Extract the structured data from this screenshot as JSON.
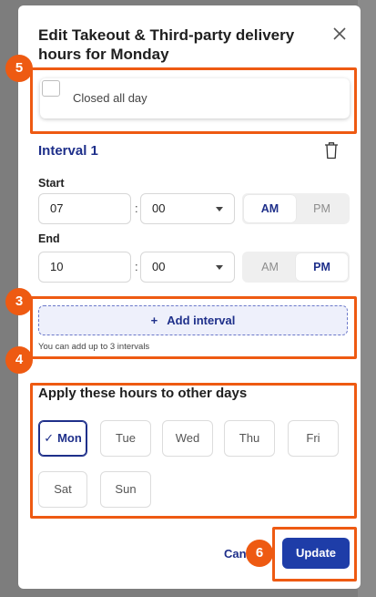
{
  "modal": {
    "title": "Edit Takeout & Third-party delivery hours for Monday",
    "closed_all_day": {
      "label": "Closed all day",
      "checked": false
    }
  },
  "interval": {
    "title": "Interval 1",
    "start": {
      "label": "Start",
      "hour": "07",
      "minute": "00",
      "am_label": "AM",
      "pm_label": "PM",
      "selected": "AM"
    },
    "end": {
      "label": "End",
      "hour": "10",
      "minute": "00",
      "am_label": "AM",
      "pm_label": "PM",
      "selected": "PM"
    },
    "colon": ":"
  },
  "add_interval": {
    "icon": "plus",
    "label": "Add interval",
    "helper": "You can add up to 3 intervals"
  },
  "apply": {
    "title": "Apply these hours to other days",
    "days": [
      {
        "label": "Mon",
        "selected": true
      },
      {
        "label": "Tue",
        "selected": false
      },
      {
        "label": "Wed",
        "selected": false
      },
      {
        "label": "Thu",
        "selected": false
      },
      {
        "label": "Fri",
        "selected": false
      },
      {
        "label": "Sat",
        "selected": false
      },
      {
        "label": "Sun",
        "selected": false
      }
    ],
    "check_glyph": "✓"
  },
  "footer": {
    "cancel_label": "Can",
    "update_label": "Update"
  },
  "annotations": {
    "color": "#ee5a12",
    "badges": [
      "5",
      "3",
      "4",
      "6"
    ]
  },
  "colors": {
    "primary": "#1e2f8a",
    "button": "#1e3da8",
    "highlight": "#ee5a12"
  }
}
